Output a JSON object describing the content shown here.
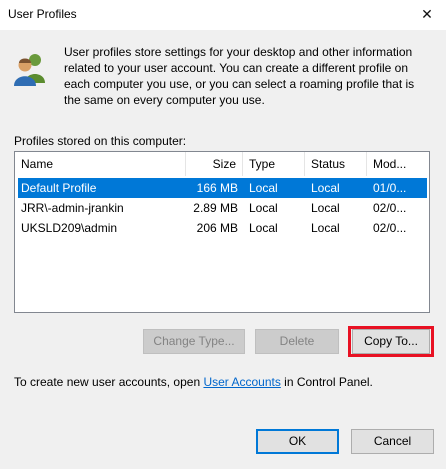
{
  "window": {
    "title": "User Profiles",
    "close_glyph": "✕"
  },
  "description": "User profiles store settings for your desktop and other information related to your user account. You can create a different profile on each computer you use, or you can select a roaming profile that is the same on every computer you use.",
  "profiles_label": "Profiles stored on this computer:",
  "profiles_table": {
    "columns": [
      "Name",
      "Size",
      "Type",
      "Status",
      "Mod..."
    ],
    "rows": [
      {
        "name": "Default Profile",
        "size": "166 MB",
        "type": "Local",
        "status": "Local",
        "modified": "01/0...",
        "selected": true
      },
      {
        "name": "JRR\\-admin-jrankin",
        "size": "2.89 MB",
        "type": "Local",
        "status": "Local",
        "modified": "02/0...",
        "selected": false
      },
      {
        "name": "UKSLD209\\admin",
        "size": "206 MB",
        "type": "Local",
        "status": "Local",
        "modified": "02/0...",
        "selected": false
      }
    ]
  },
  "buttons": {
    "change_type": "Change Type...",
    "delete": "Delete",
    "copy_to": "Copy To...",
    "ok": "OK",
    "cancel": "Cancel"
  },
  "footer": {
    "prefix": "To create new user accounts, open ",
    "link": "User Accounts",
    "suffix": " in Control Panel."
  },
  "colors": {
    "selection": "#0078d7",
    "highlight_box": "#e81123",
    "link": "#0066cc",
    "ok_border": "#0078d7"
  },
  "icons": [
    "users-icon",
    "close-icon"
  ]
}
